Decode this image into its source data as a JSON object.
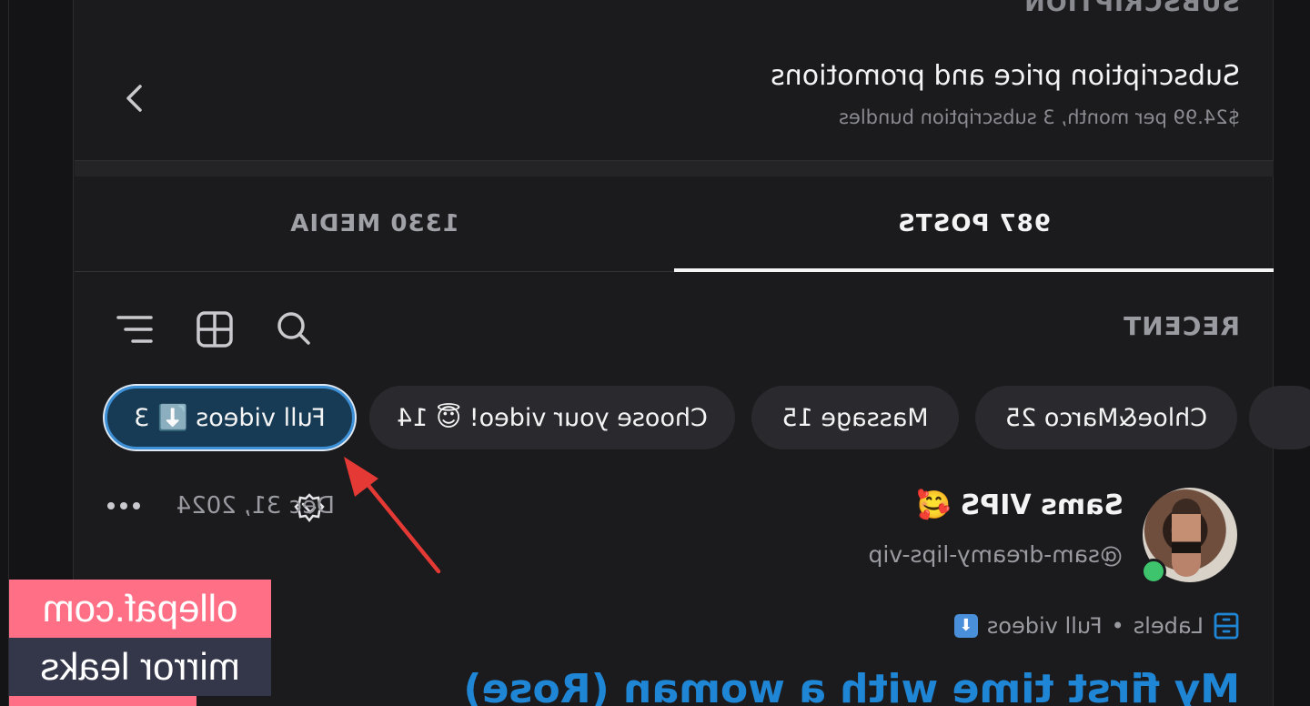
{
  "subscription": {
    "section_label": "SUBSCRIPTION",
    "title": "Subscription price and promotions",
    "description": "$24.99 per month, 3 subscription bundles",
    "icon": "chevron-right-icon"
  },
  "tabs": {
    "posts": "987 POSTS",
    "media": "1330 MEDIA",
    "active": "posts"
  },
  "toolbar": {
    "sort_label": "RECENT",
    "icons": [
      "search-icon",
      "grid-icon",
      "filter-list-icon"
    ]
  },
  "chips": [
    {
      "label": "Full videos ⬇️ 3",
      "active": true
    },
    {
      "label": "Choose your video! 😇 14",
      "active": false
    },
    {
      "label": "Massage 15",
      "active": false
    },
    {
      "label": "Chloe&Marco 25",
      "active": false
    }
  ],
  "post": {
    "author_name": "Sams VIPS 🥰",
    "handle": "@sam-dreamy-lips-vip",
    "date": "Dec 31, 2024",
    "labels_prefix": "Labels",
    "labels_separator": "•",
    "label_value": "Full videos",
    "title": "My first time with a woman (Rose)",
    "verified_icon": "verified-badge-icon",
    "more_icon": "more-horizontal-icon"
  },
  "annotation": {
    "arrow_color": "#e53935"
  },
  "watermark": {
    "line1": "ollepaf.com",
    "line2": "mirror leaks"
  },
  "colors": {
    "accent": "#1f86d6",
    "active_chip_bg": "#173b54",
    "online": "#3ec46d"
  }
}
